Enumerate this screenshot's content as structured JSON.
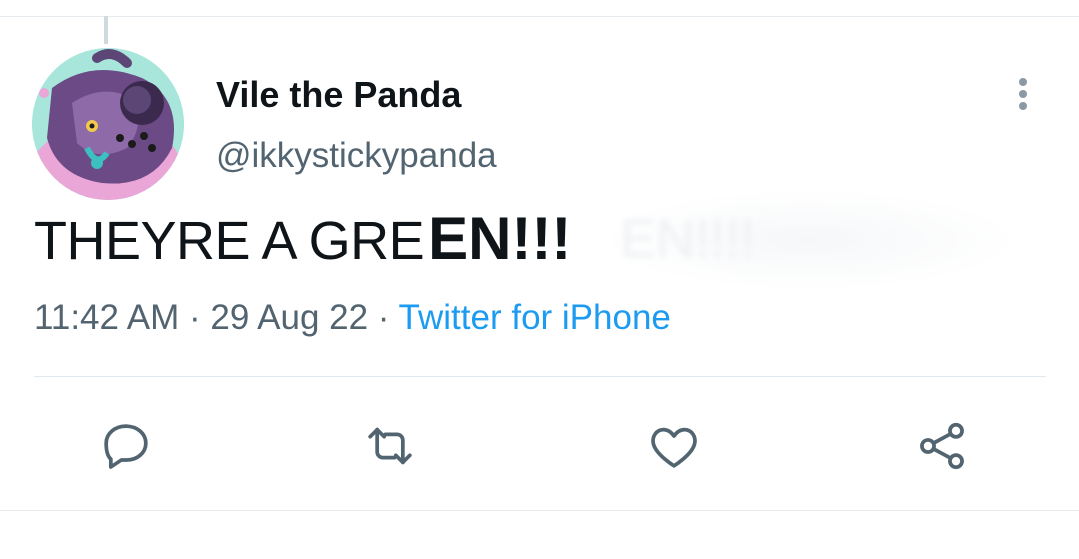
{
  "tweet": {
    "display_name": "Vile the Panda",
    "handle": "@ikkystickypanda",
    "text_part_a": "THEYRE A GRE",
    "text_part_b": "EN!!!",
    "ghost_text": "EN!!!!",
    "time": "11:42 AM",
    "separator": "·",
    "date": "29 Aug 22",
    "source": "Twitter for iPhone"
  },
  "actions": [
    "reply-icon",
    "retweet-icon",
    "like-icon",
    "share-icon"
  ],
  "colors": {
    "text_primary": "#0f1419",
    "text_secondary": "#536471",
    "link": "#1d9bf0",
    "icon": "#536471",
    "divider": "#e1e8ed"
  }
}
